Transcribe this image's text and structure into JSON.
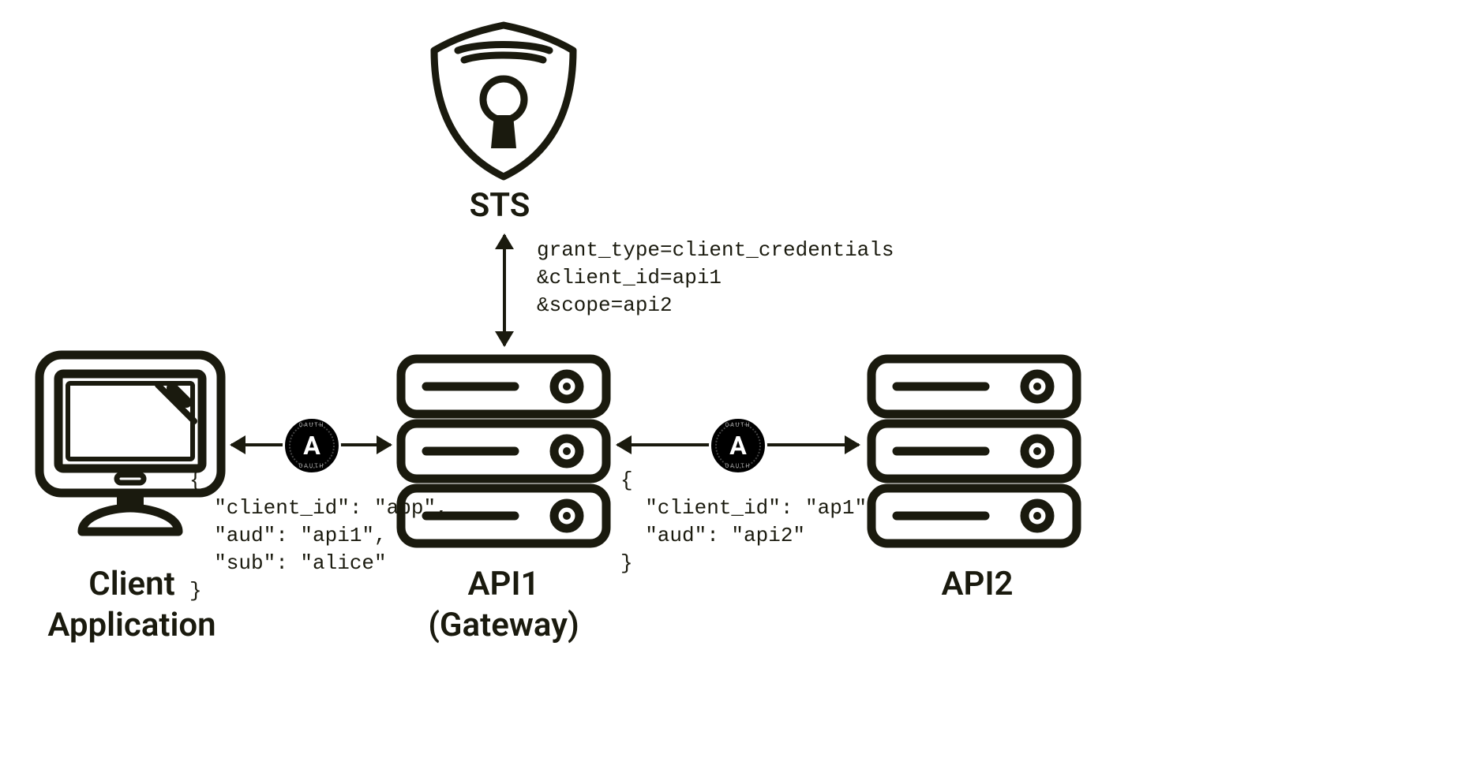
{
  "nodes": {
    "sts": {
      "label": "STS"
    },
    "client": {
      "line1": "Client",
      "line2": "Application"
    },
    "api1": {
      "line1": "API1",
      "line2": "(Gateway)"
    },
    "api2": {
      "label": "API2"
    }
  },
  "edges": {
    "sts_request": "grant_type=client_credentials\n&client_id=api1\n&scope=api2",
    "token1": "{\n  \"client_id\": \"app\",\n  \"aud\": \"api1\",\n  \"sub\": \"alice\"\n}",
    "token2": "{\n  \"client_id\": \"ap1\",\n  \"aud\": \"api2\"\n}"
  },
  "badge": {
    "text": "OAUTH"
  },
  "colors": {
    "ink": "#1a1a0e"
  }
}
